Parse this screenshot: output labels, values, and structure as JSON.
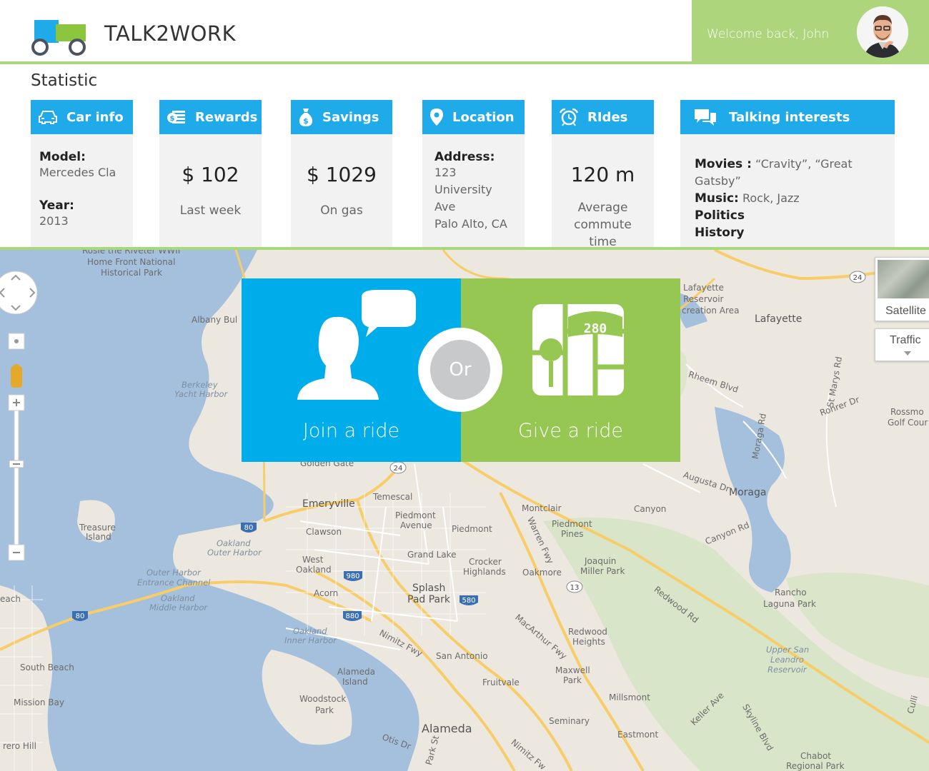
{
  "app": {
    "brand": "TALK2WORK",
    "welcome": "Welcome back, John"
  },
  "statistic": {
    "title": "Statistic",
    "cards": {
      "car_info": {
        "title": "Car info",
        "icon": "car-icon",
        "model_label": "Model:",
        "model_value": "Mercedes Cla",
        "year_label": "Year:",
        "year_value": "2013"
      },
      "rewards": {
        "title": "Rewards",
        "icon": "money-icon",
        "amount": "$ 102",
        "caption": "Last week"
      },
      "savings": {
        "title": "Savings",
        "icon": "money-bag-icon",
        "amount": "$ 1029",
        "caption": "On gas"
      },
      "location": {
        "title": "Location",
        "icon": "map-pin-icon",
        "address_label": "Address:",
        "line1": "123",
        "line2": "University Ave",
        "line3": "Palo Alto, CA"
      },
      "rides": {
        "title": "RIdes",
        "icon": "alarm-clock-icon",
        "amount": "120 m",
        "caption_line1": "Average",
        "caption_line2": "commute time"
      },
      "interests": {
        "title": "Talking interests",
        "icon": "chat-bubbles-icon",
        "movies_label": "Movies :",
        "movies_value": "“Cravity”, “Great Gatsby”",
        "music_label": "Music:",
        "music_value": "Rock, Jazz",
        "politics": "Politics",
        "history": "History"
      }
    }
  },
  "actions": {
    "join": "Join a ride",
    "or": "Or",
    "give": "Give a ride",
    "highway_number": "280"
  },
  "map": {
    "satellite": "Satellite",
    "traffic": "Traffic",
    "labels": {
      "rosie": "Rosie the Riveter WWII",
      "home_front": "Home Front National",
      "historical": "Historical Park",
      "albany": "Albany Bul",
      "berkeley_yacht1": "Berkeley",
      "berkeley_yacht2": "Yacht Harbor",
      "treasure1": "Treasure",
      "treasure2": "Island",
      "oakland_outer1": "Oakland",
      "oakland_outer2": "Outer Harbor",
      "outer_harbor1": "Outer Harbor",
      "outer_harbor2": "Entrance Channel",
      "oakland_middle1": "Oakland",
      "oakland_middle2": "Middle Harbor",
      "beach": "each",
      "south_beach": "South Beach",
      "mission_bay": "Mission Bay",
      "rero_hill": "rero Hill",
      "emeryville": "Emeryville",
      "clawson": "Clawson",
      "west_oakland1": "West",
      "west_oakland2": "Oakland",
      "acorn": "Acorn",
      "temescal": "Temescal",
      "piedmont_ave1": "Piedmont",
      "piedmont_ave2": "Avenue",
      "piedmont": "Piedmont",
      "grand_lake": "Grand Lake",
      "crocker1": "Crocker",
      "crocker2": "Highlands",
      "oakmore": "Oakmore",
      "splash1": "Splash",
      "splash2": "Pad Park",
      "oakland_inner1": "Oakland",
      "oakland_inner2": "Inner Harbor",
      "alameda_island1": "Alameda",
      "alameda_island2": "Island",
      "woodstock1": "Woodstock",
      "woodstock2": "Park",
      "alameda": "Alameda",
      "san_antonio": "San Antonio",
      "fruitvale": "Fruitvale",
      "maxwell1": "Maxwell",
      "maxwell2": "Park",
      "millsmont": "Millsmont",
      "seminary": "Seminary",
      "eastmont": "Eastmont",
      "montclair": "Montclair",
      "piedmont_pines1": "Piedmont",
      "piedmont_pines2": "Pines",
      "joaquin1": "Joaquin",
      "joaquin2": "Miller Park",
      "redwood1": "Redwood",
      "redwood2": "Heights",
      "canyon": "Canyon",
      "moraga": "Moraga",
      "lafayette": "Lafayette",
      "lafayette_res1": "Lafayette",
      "lafayette_res2": "Reservoir",
      "lafayette_res3": "creation Area",
      "rancho1": "Rancho",
      "rancho2": "Laguna Park",
      "upper_san1": "Upper San",
      "upper_san2": "Leandro",
      "upper_san3": "Reservoir",
      "chabot1": "Chabot",
      "chabot2": "Regional Park",
      "rossmo1": "Rossmo",
      "rossmo2": "Golf Cour",
      "rheem": "Rheem Blvd",
      "moraga_rd": "Moraga Rd",
      "augusta": "Augusta Dr",
      "canyon_rd": "Canyon Rd",
      "redwood_rd": "Redwood Rd",
      "warren": "Warren Fwy",
      "macarthur": "MacArthur Fwy",
      "nimitz": "Nimitz Fwy",
      "nimitz2": "Nimitz Fw",
      "keller": "Keller Ave",
      "skyline": "Skyline Blvd",
      "st_marys": "St Marys Rd",
      "rohrer": "Rohrer Dr",
      "golden_gate": "Golden Gate",
      "park_st": "Park St",
      "otis": "Otis Dr",
      "culli": "Culli"
    },
    "shields": {
      "s24a": "24",
      "s24b": "24",
      "s80a": "80",
      "s80b": "80",
      "s980": "980",
      "s580": "580",
      "s880": "880",
      "s13": "13"
    }
  },
  "colors": {
    "accent_blue": "#1faaea",
    "accent_green": "#96c752",
    "header_green": "#acd57c"
  }
}
